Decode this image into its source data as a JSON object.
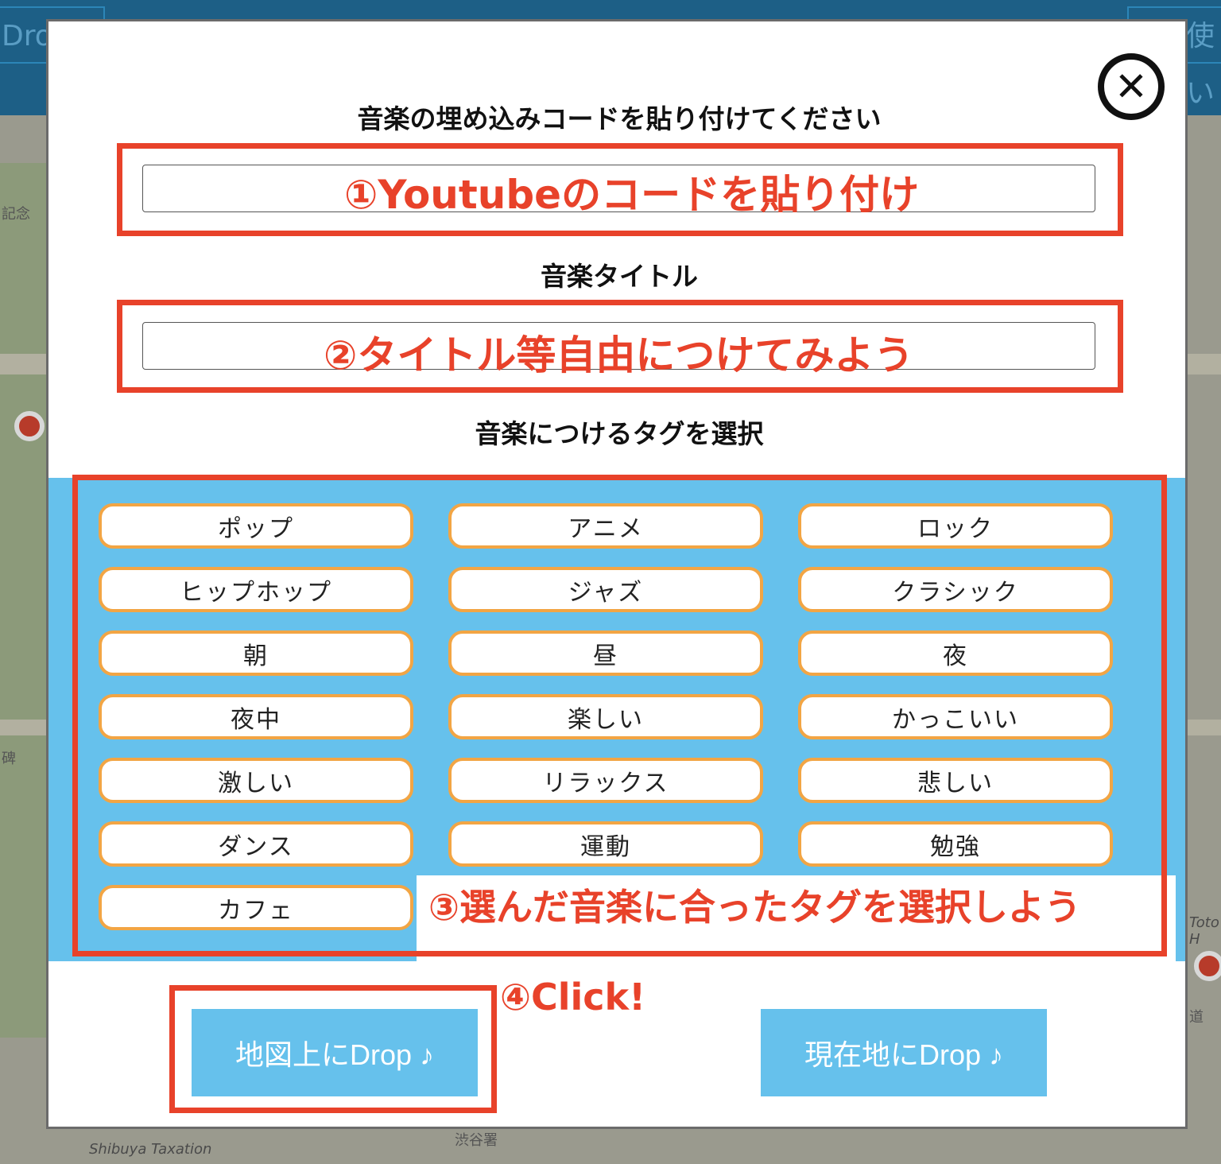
{
  "background": {
    "left_button": "Drop",
    "right_button": "使い",
    "map_labels": [
      "記念",
      "Shibuya Taxation",
      "渋谷署",
      "Toto H",
      "碑",
      "道"
    ]
  },
  "modal": {
    "close_icon": "close-circle-icon",
    "embed_label": "音楽の埋め込みコードを貼り付けてください",
    "embed_value": "",
    "title_label": "音楽タイトル",
    "title_value": "",
    "tag_label": "音楽につけるタグを選択",
    "tags": [
      "ポップ",
      "アニメ",
      "ロック",
      "ヒップホップ",
      "ジャズ",
      "クラシック",
      "朝",
      "昼",
      "夜",
      "夜中",
      "楽しい",
      "かっこいい",
      "激しい",
      "リラックス",
      "悲しい",
      "ダンス",
      "運動",
      "勉強",
      "カフェ"
    ],
    "drop_map_button": "地図上にDrop ♪",
    "drop_here_button": "現在地にDrop ♪"
  },
  "annotations": {
    "step1": "①Youtubeのコードを貼り付け",
    "step2": "②タイトル等自由につけてみよう",
    "step3": "③選んだ音楽に合ったタグを選択しよう",
    "step4": "④Click!",
    "color": "#e8422a"
  },
  "colors": {
    "tag_area": "#66c1ec",
    "tag_border": "#f2a544",
    "button": "#66c1ec"
  }
}
